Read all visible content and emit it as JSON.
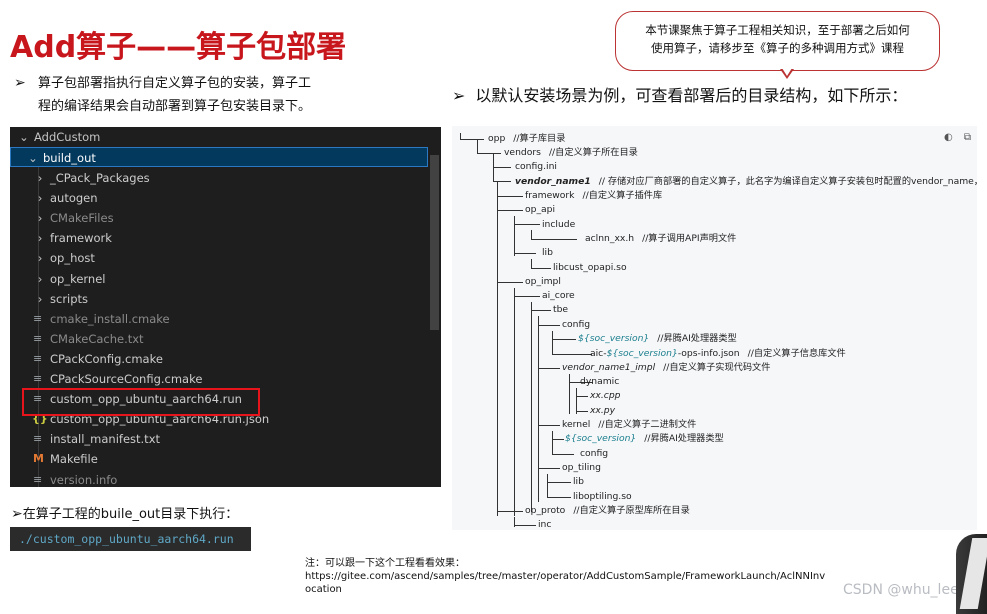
{
  "title": "Add算子——算子包部署",
  "callout": {
    "line1": "本节课聚焦于算子工程相关知识，至于部署之后如何",
    "line2": "使用算子，请移步至《算子的多种调用方式》课程"
  },
  "left_bullet": {
    "arrow": "➢",
    "line1": "算子包部署指执行自定义算子包的安装，算子工",
    "line2": "程的编译结果会自动部署到算子包安装目录下。"
  },
  "right_bullet": {
    "arrow": "➢",
    "text": "以默认安装场景为例，可查看部署后的目录结构，如下所示："
  },
  "explorer": {
    "root": "AddCustom",
    "selected": "build_out",
    "items": [
      {
        "label": "_CPack_Packages",
        "type": "folder"
      },
      {
        "label": "autogen",
        "type": "folder"
      },
      {
        "label": "CMakeFiles",
        "type": "folder",
        "dim": true
      },
      {
        "label": "framework",
        "type": "folder"
      },
      {
        "label": "op_host",
        "type": "folder"
      },
      {
        "label": "op_kernel",
        "type": "folder"
      },
      {
        "label": "scripts",
        "type": "folder"
      },
      {
        "label": "cmake_install.cmake",
        "type": "file",
        "dim": true
      },
      {
        "label": "CMakeCache.txt",
        "type": "file",
        "dim": true
      },
      {
        "label": "CPackConfig.cmake",
        "type": "file"
      },
      {
        "label": "CPackSourceConfig.cmake",
        "type": "file"
      },
      {
        "label": "custom_opp_ubuntu_aarch64.run",
        "type": "file"
      },
      {
        "label": "custom_opp_ubuntu_aarch64.run.json",
        "type": "json"
      },
      {
        "label": "install_manifest.txt",
        "type": "file"
      },
      {
        "label": "Makefile",
        "type": "makefile"
      },
      {
        "label": "version.info",
        "type": "file",
        "dim": true
      }
    ]
  },
  "bottom_bullet": {
    "arrow": "➢",
    "text": "在算子工程的buile_out目录下执行："
  },
  "command": "./custom_opp_ubuntu_aarch64.run",
  "tree": {
    "opp": "opp",
    "opp_c": "//算子库目录",
    "vendors": "vendors",
    "vendors_c": "//自定义算子所在目录",
    "config_ini": "config.ini",
    "vendor_name1": "vendor_name1",
    "vendor_name1_c": "// 存储对应厂商部署的自定义算子，此名字为编译自定义算子安装包时配置的vendor_name，",
    "framework": "framework",
    "framework_c": "//自定义算子插件库",
    "op_api": "op_api",
    "include": "include",
    "aclnn": "aclnn_xx.h",
    "aclnn_c": "//算子调用API声明文件",
    "lib": "lib",
    "libcust": "libcust_opapi.so",
    "op_impl": "op_impl",
    "ai_core": "ai_core",
    "tbe": "tbe",
    "config": "config",
    "soc_version": "${soc_version}",
    "soc_version_c": "//昇腾AI处理器类型",
    "aic_prefix": "aic-",
    "aic_suffix": "-ops-info.json",
    "aic_c": "//自定义算子信息库文件",
    "vendor_impl": "vendor_name1_impl",
    "vendor_impl_c": "//自定义算子实现代码文件",
    "dynamic": "dynamic",
    "xx_cpp": "xx.cpp",
    "xx_py": "xx.py",
    "kernel": "kernel",
    "kernel_c": "//自定义算子二进制文件",
    "soc_version2_c": "//昇腾AI处理器类型",
    "config2": "config",
    "op_tiling": "op_tiling",
    "lib2": "lib",
    "liboptiling": "liboptiling.so",
    "op_proto": "op_proto",
    "op_proto_c": "//自定义算子原型库所在目录",
    "inc": "inc"
  },
  "note": {
    "line1": "注：可以跟一下这个工程看看效果：",
    "line2": "https://gitee.com/ascend/samples/tree/master/operator/AddCustomSample/FrameworkLaunch/AclNNInv",
    "line3": "ocation"
  },
  "watermark": "CSDN @whu_lee"
}
